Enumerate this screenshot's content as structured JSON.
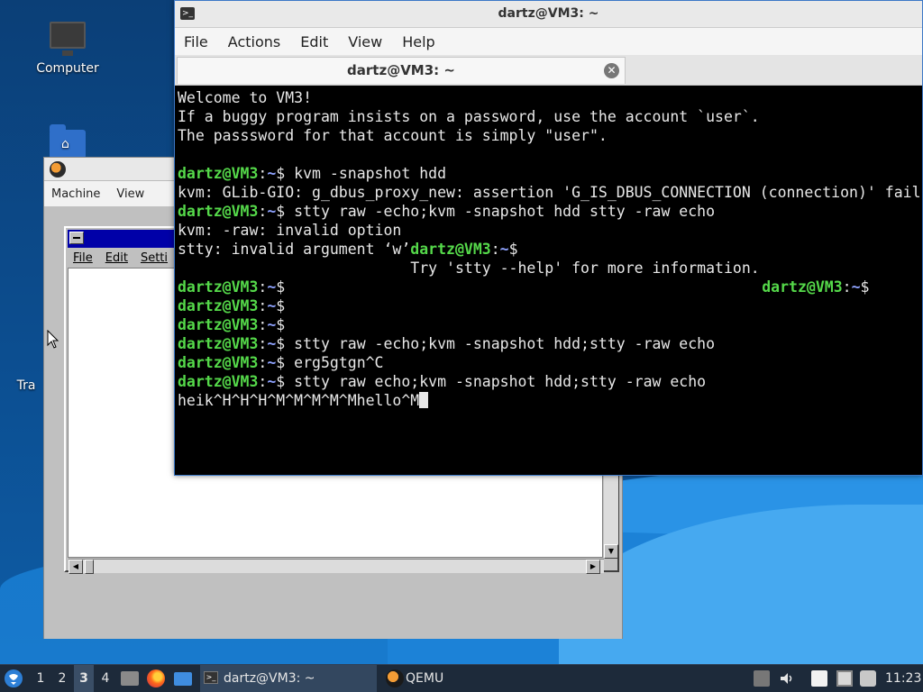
{
  "desktop": {
    "icons": [
      {
        "label": "Computer"
      },
      {
        "label": "Home"
      },
      {
        "label": "Tra"
      }
    ]
  },
  "qemu": {
    "menu": [
      "Machine",
      "View"
    ],
    "guest_window": {
      "menu": [
        "File",
        "Edit",
        "Setti"
      ]
    }
  },
  "terminal": {
    "window_title": "dartz@VM3: ~",
    "menu": [
      "File",
      "Actions",
      "Edit",
      "View",
      "Help"
    ],
    "tab_title": "dartz@VM3: ~",
    "prompt_user": "dartz@VM3",
    "prompt_path": "~",
    "lines": [
      "Welcome to VM3!",
      "If a buggy program insists on a password, use the account `user`.",
      "The passsword for that account is simply \"user\".",
      "",
      "kvm -snapshot hdd",
      "kvm: GLib-GIO: g_dbus_proxy_new: assertion 'G_IS_DBUS_CONNECTION (connection)' fail",
      "stty raw -echo;kvm -snapshot hdd stty -raw echo",
      "kvm: -raw: invalid option",
      "stty: invalid argument ‘w’",
      "                          Try 'stty --help' for more information.",
      "",
      "",
      "",
      "stty raw -echo;kvm -snapshot hdd;stty -raw echo",
      "erg5gtgn^C",
      "stty raw echo;kvm -snapshot hdd;stty -raw echo",
      "heik^H^H^H^M^M^M^M^Mhello^M"
    ]
  },
  "taskbar": {
    "workspaces": [
      "1",
      "2",
      "3",
      "4"
    ],
    "active_workspace": "3",
    "tasks": [
      {
        "label": "dartz@VM3: ~"
      },
      {
        "label": "QEMU"
      }
    ],
    "clock": "11:23"
  }
}
